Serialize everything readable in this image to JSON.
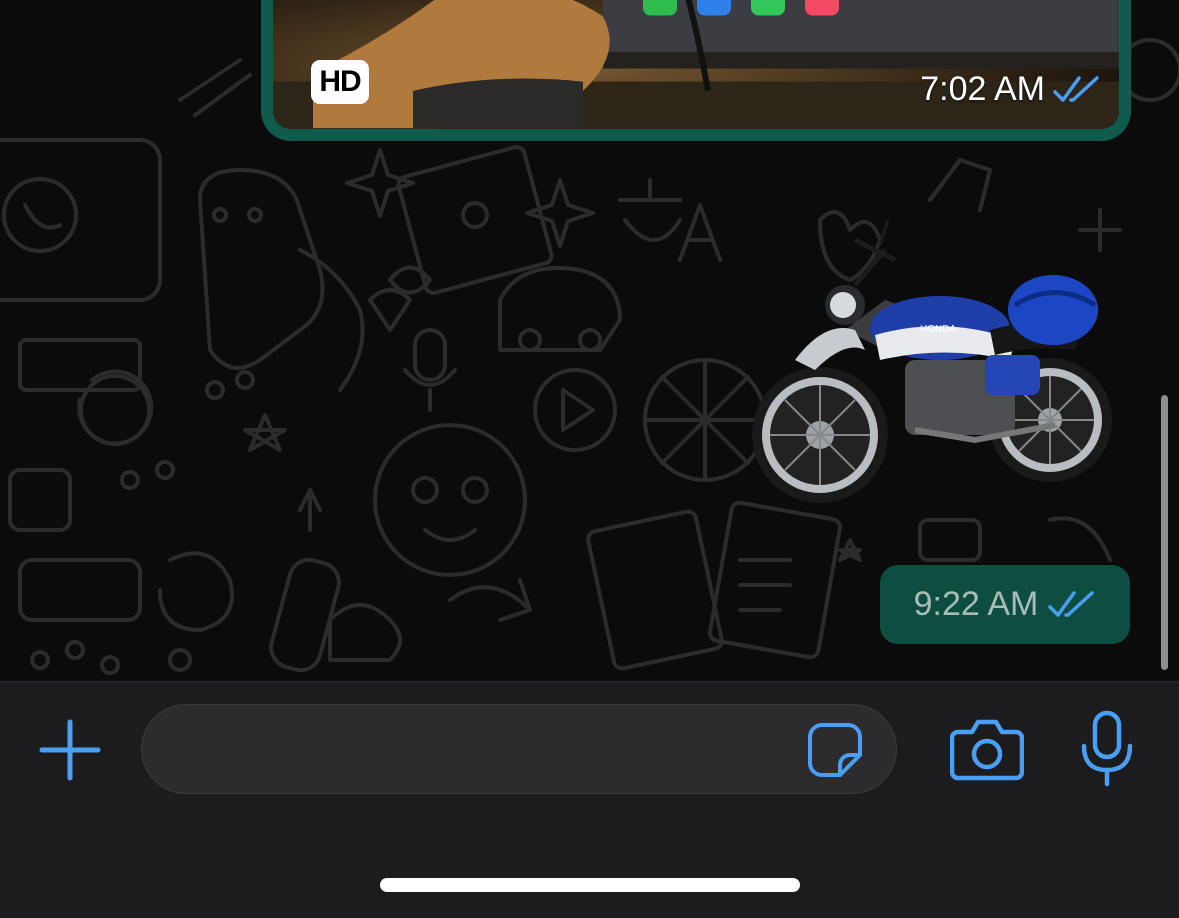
{
  "chat": {
    "image_message": {
      "badge": "HD",
      "time": "7:02 AM",
      "status_icon": "double-check-read-icon"
    },
    "sticker_message": {
      "description_icon": "motorcycle-sticker",
      "brand_text": "HONDA",
      "time": "9:22 AM",
      "status_icon": "double-check-read-icon"
    }
  },
  "composer": {
    "add_icon": "plus-icon",
    "input_value": "",
    "input_placeholder": "",
    "sticker_icon": "sticker-icon",
    "camera_icon": "camera-icon",
    "mic_icon": "microphone-icon"
  },
  "colors": {
    "accent": "#4a9ff5",
    "bubble": "#0d4e41",
    "bubble_border": "#0f5c4c",
    "composer_bg": "#1c1c1e"
  }
}
